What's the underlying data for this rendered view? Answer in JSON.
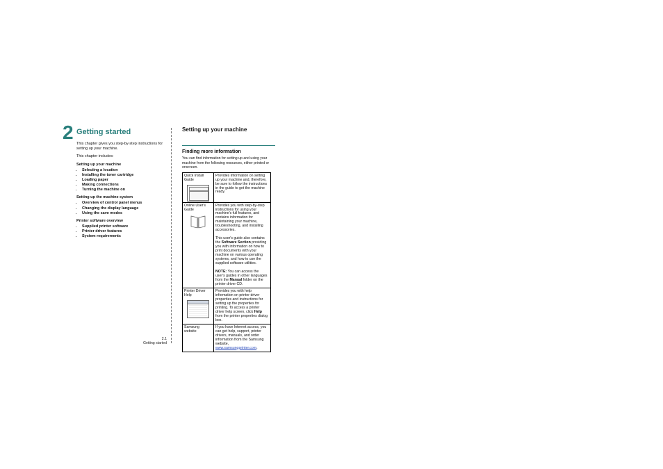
{
  "chapter_number": "2",
  "left": {
    "title": "Getting started",
    "intro": "This chapter gives you step-by-step instructions for setting up your machine.",
    "includes_label": "This chapter includes:",
    "section_a": "Setting up your machine",
    "list_a": [
      "Selecting a location",
      "Installing the toner cartridge",
      "Loading paper",
      "Making connections",
      "Turning the machine on"
    ],
    "section_b": "Setting up the machine system",
    "list_b": [
      "Overview of control panel menus",
      "Changing the display language",
      "Using the save modes"
    ],
    "section_c": "Printer software overview",
    "list_c": [
      "Supplied printer software",
      "Printer driver features",
      "System requirements"
    ]
  },
  "right": {
    "h1": "Setting up your machine",
    "h2": "Finding more information",
    "p": "You can find information for setting up and using your machine from the following resources, either printed or onscreen.",
    "rows": [
      {
        "name": "Quick Install Guide",
        "body_parts": [
          "Provides information on setting up your machine and, therefore, be sure to follow the instructions in the guide to get the machine ready."
        ]
      },
      {
        "name": "Online User's Guide",
        "body_parts": [
          "Provides you with step-by-step instructions for using your machine's full features, and contains information for maintaining your machine, troubleshooting, and installing accessories.",
          "This user's guide also contains the ",
          "Software Section",
          " providing you with information on how to print documents with your machine on various operating systems, and how to use the supplied software utilities.",
          "NOTE:",
          " You can access the user's guides in other languages from the ",
          "Manual",
          " folder on the printer driver CD."
        ]
      },
      {
        "name": "Printer Driver Help",
        "body_parts": [
          "Provides you with help information on printer driver properties and instructions for setting up the properties for printing. To access a printer driver help screen, click ",
          "Help",
          " from the printer properties dialog box."
        ]
      },
      {
        "name": "Samsung website",
        "body_parts": [
          "If you have Internet access, you can get help, support, printer drivers, manuals, and order information from the Samsung website, ",
          "www.samsungprinter.com"
        ]
      }
    ]
  },
  "footer": {
    "page": "2.1",
    "label": "Getting started"
  }
}
